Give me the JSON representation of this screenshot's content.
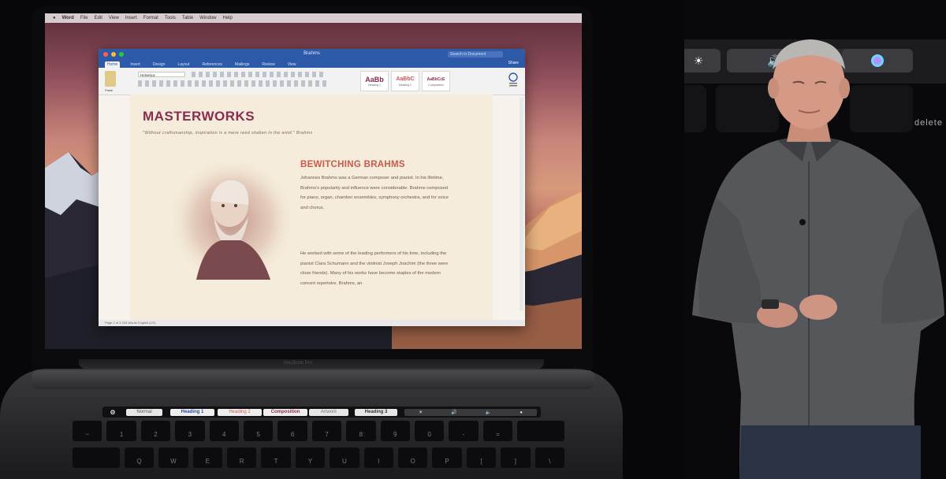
{
  "macos": {
    "menubar_items": [
      "Word",
      "File",
      "Edit",
      "View",
      "Insert",
      "Format",
      "Tools",
      "Table",
      "Window",
      "Help"
    ]
  },
  "word": {
    "doc_title": "Brahms",
    "search_placeholder": "Search in Document",
    "share_label": "Share",
    "ribbon_tabs": [
      "Home",
      "Insert",
      "Design",
      "Layout",
      "References",
      "Mailings",
      "Review",
      "View"
    ],
    "active_tab": "Home",
    "paste_label": "Paste",
    "font_name": "Helvetica",
    "styles": [
      {
        "sample": "AaBb",
        "name": "Heading 1",
        "color": "#8a2b4f"
      },
      {
        "sample": "AaBbC",
        "name": "Heading 2",
        "color": "#d05a52"
      },
      {
        "sample": "AaBbCcE",
        "name": "Composition",
        "color": "#8a2b4f"
      }
    ],
    "styles_pane_label": "Styles Pane",
    "status_text": "Page 1 of 3    234 Words    English (US)"
  },
  "document": {
    "heading": "MASTERWORKS",
    "quote": "\"Without craftsmanship, inspiration is a mere reed shaken in the wind.\" Brahms",
    "subheading": "BEWITCHING BRAHMS",
    "paragraph1": "Johannes Brahms was a German composer and pianist. In his lifetime, Brahms's popularity and influence were considerable. Brahms composed for piano, organ, chamber ensembles, symphony orchestra, and for voice and chorus.",
    "paragraph2": "He worked with some of the leading performers of his time, including the pianist Clara Schumann and the violinist Joseph Joachim (the three were close friends). Many of his works have become staples of the modern concert repertoire. Brahms, an"
  },
  "laptop": {
    "brand": "MacBook Pro"
  },
  "touchbar": {
    "esc_icon": "gear-icon",
    "items": [
      "Normal",
      "Heading 1",
      "Heading 2",
      "Composition",
      "Artwork",
      "Heading 3"
    ],
    "controls": [
      "brightness-icon",
      "volume-icon",
      "mute-icon",
      "siri-icon"
    ]
  },
  "bigscreen": {
    "delete_label": "delete",
    "controls": [
      "brightness-icon",
      "volume-icon",
      "siri-icon"
    ]
  },
  "colors": {
    "word_blue": "#2d5aa8",
    "heading_maroon": "#8a2b4f",
    "subheading_coral": "#d0574e",
    "page_bg": "#f5ecdb"
  }
}
